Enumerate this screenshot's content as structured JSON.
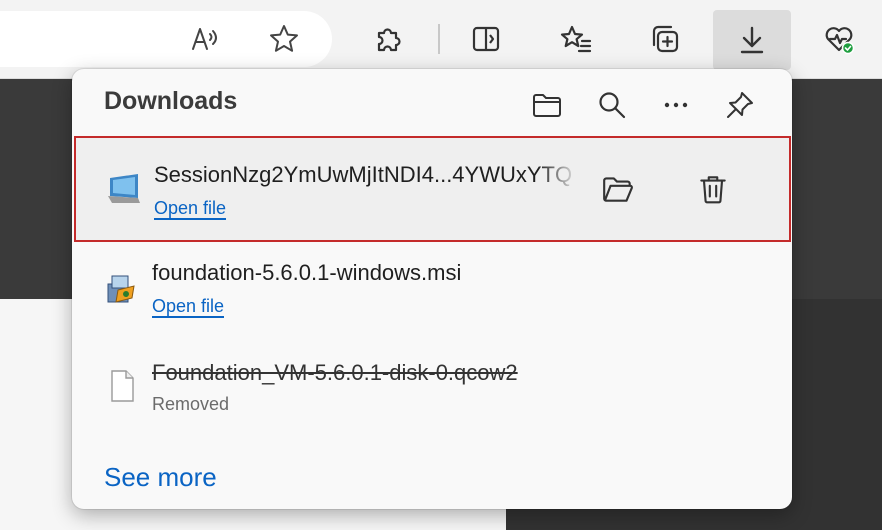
{
  "toolbar": {
    "read_aloud_icon": "read-aloud-icon",
    "favorite_icon": "star-icon",
    "extensions_icon": "puzzle-icon",
    "split_screen_icon": "split-screen-icon",
    "favorites_icon": "favorites-list-icon",
    "collections_icon": "collections-icon",
    "downloads_icon": "download-icon",
    "health_icon": "browser-essentials-icon"
  },
  "downloads": {
    "title": "Downloads",
    "header_icons": [
      "folder-icon",
      "search-icon",
      "more-icon",
      "pin-icon"
    ],
    "items": [
      {
        "name": "SessionNzg2YmUwMjItNDI4...4YWUxYTQ",
        "action": "Open file",
        "icon": "remote-desktop-icon",
        "highlighted": true
      },
      {
        "name": "foundation-5.6.0.1-windows.msi",
        "action": "Open file",
        "icon": "installer-icon",
        "highlighted": false
      },
      {
        "name": "Foundation_VM-5.6.0.1-disk-0.qcow2",
        "status": "Removed",
        "icon": "blank-file-icon",
        "highlighted": false
      }
    ],
    "see_more": "See more"
  },
  "colors": {
    "accent": "#0a64c4",
    "highlight_border": "#c42b2b",
    "health_badge": "#1e9e3f"
  }
}
